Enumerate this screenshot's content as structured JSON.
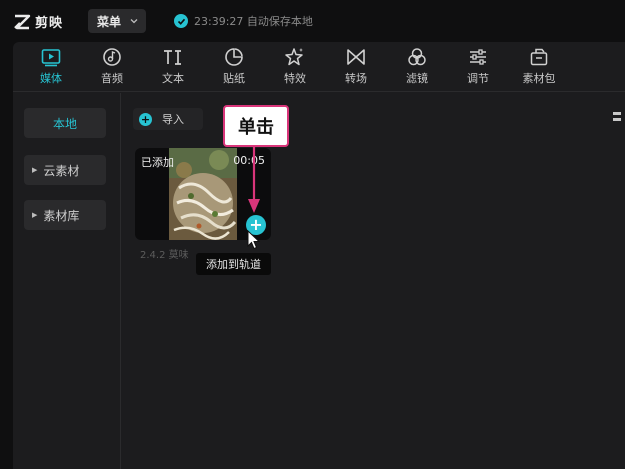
{
  "app": {
    "logo_text": "剪映"
  },
  "topbar": {
    "menu_label": "菜单",
    "autosave_text": "23:39:27 自动保存本地"
  },
  "tabs": [
    {
      "label": "媒体",
      "icon": "media-icon",
      "active": true
    },
    {
      "label": "音频",
      "icon": "audio-icon"
    },
    {
      "label": "文本",
      "icon": "text-icon"
    },
    {
      "label": "贴纸",
      "icon": "sticker-icon"
    },
    {
      "label": "特效",
      "icon": "effects-icon"
    },
    {
      "label": "转场",
      "icon": "transition-icon"
    },
    {
      "label": "滤镜",
      "icon": "filter-icon"
    },
    {
      "label": "调节",
      "icon": "adjust-icon"
    },
    {
      "label": "素材包",
      "icon": "material-pack-icon"
    }
  ],
  "sidebar": {
    "items": [
      {
        "label": "本地",
        "active": true
      },
      {
        "label": "云素材"
      },
      {
        "label": "素材库"
      }
    ]
  },
  "content": {
    "import_label": "导入",
    "media_card": {
      "status": "已添加",
      "duration": "00:05",
      "filename": "2.4.2 莫味",
      "add_tooltip": "添加到轨道"
    }
  },
  "annotation": {
    "text": "单击"
  },
  "colors": {
    "accent": "#27c3d2",
    "annotation_border": "#d9357a",
    "panel_bg": "#1c1c1e",
    "window_bg": "#0f0f10"
  }
}
